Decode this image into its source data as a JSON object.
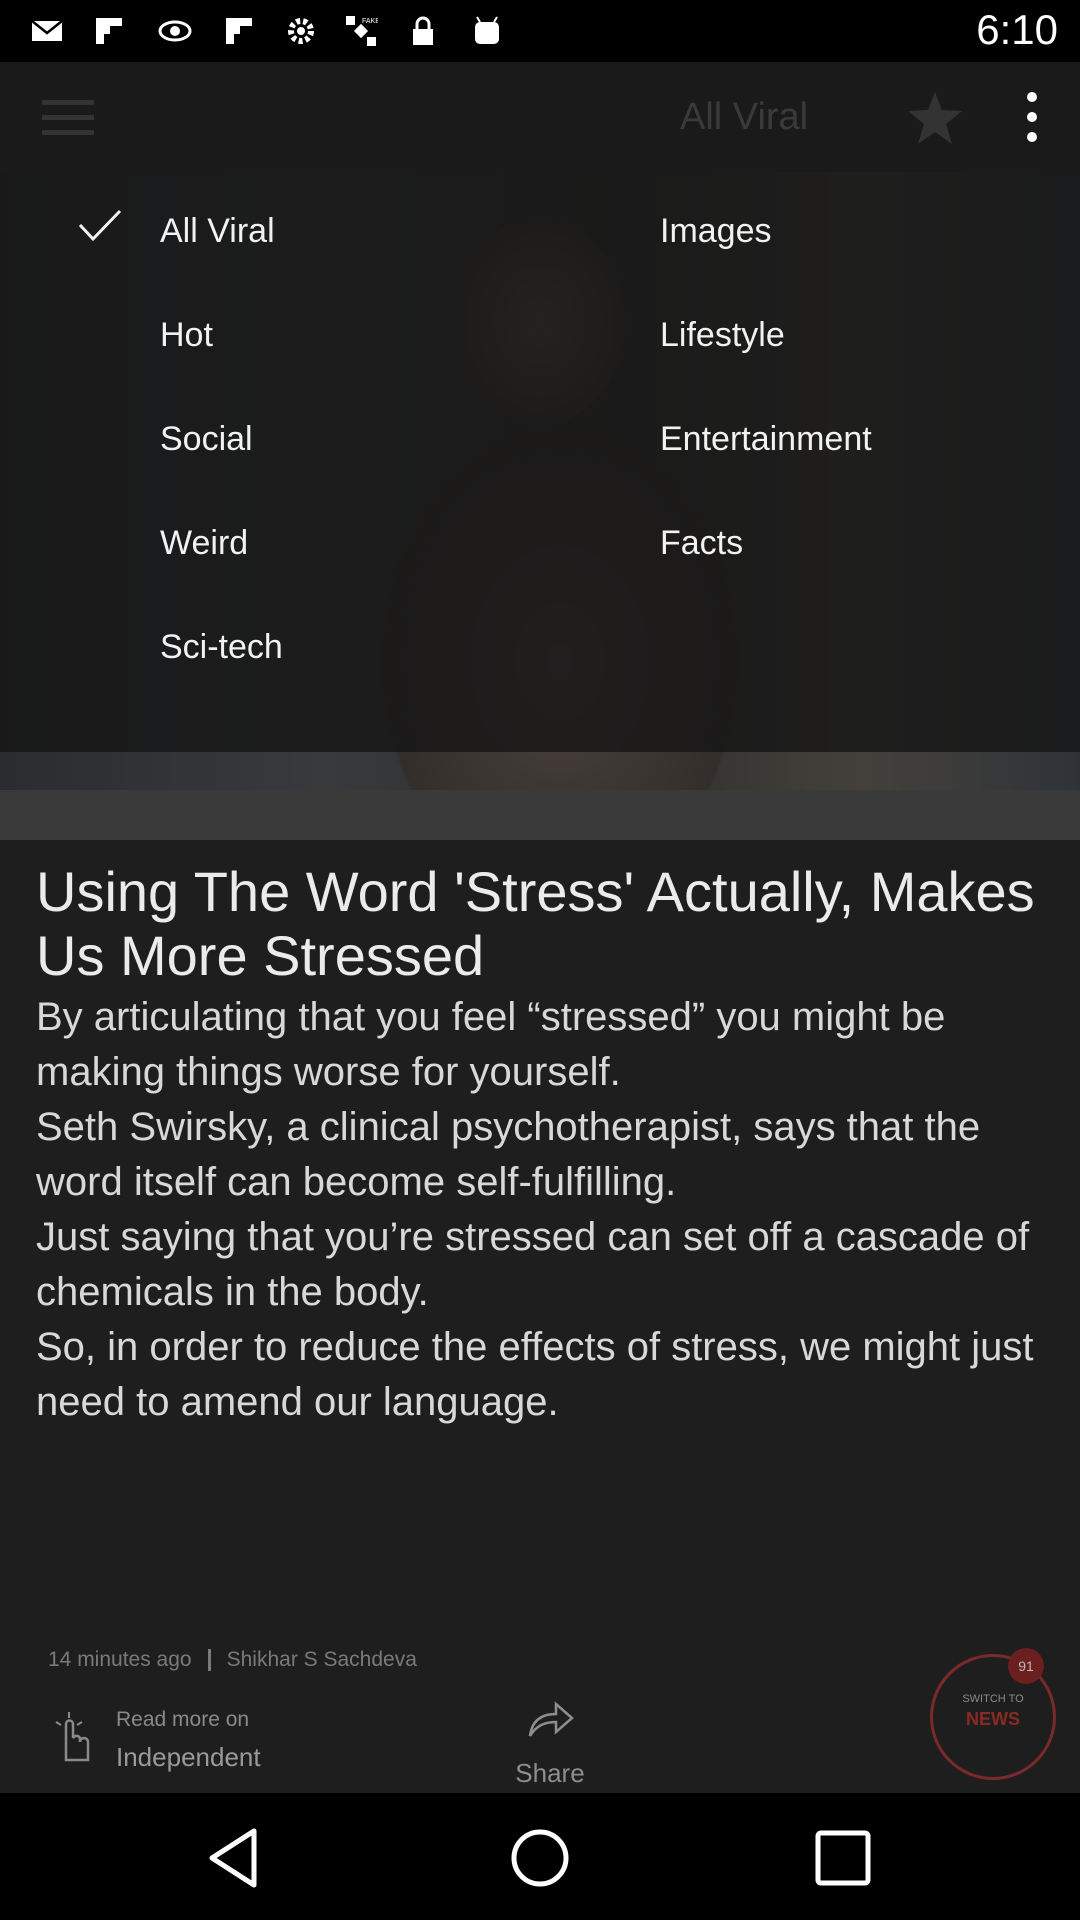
{
  "status_bar": {
    "time": "6:10",
    "icons": [
      "mail-icon",
      "flipboard-icon",
      "eye-icon",
      "flipboard-icon",
      "gear-icon",
      "satellite-icon",
      "lock-icon",
      "android-icon"
    ]
  },
  "app_bar": {
    "title": "All Viral",
    "icons": [
      "menu-icon",
      "star-icon",
      "more-vert-icon"
    ]
  },
  "filter_menu": {
    "selected": "All Viral",
    "left_column": [
      "All Viral",
      "Hot",
      "Social",
      "Weird",
      "Sci-tech"
    ],
    "right_column": [
      "Images",
      "Lifestyle",
      "Entertainment",
      "Facts"
    ]
  },
  "article": {
    "headline": "Using The Word 'Stress' Actually, Makes Us More Stressed",
    "body": "By articulating that you feel “stressed” you might be making things worse for yourself.\nSeth Swirsky, a clinical psychotherapist, says that the word itself can become self-fulfilling.\nJust saying that you’re stressed can set off a cascade of chemicals in the body.\nSo, in order to reduce the effects of stress, we might just need to amend our language.",
    "time_ago": "14 minutes ago",
    "author": "Shikhar S Sachdeva",
    "read_more_label": "Read more on",
    "source": "Independent",
    "share_label": "Share"
  },
  "switch_button": {
    "small_label": "SWITCH TO",
    "big_label": "NEWS",
    "badge_count": "91"
  },
  "colors": {
    "menu_overlay": "#141414",
    "accent_red": "#8a2a24",
    "text_primary": "#f2f2f2"
  },
  "nav_bar": {
    "buttons": [
      "back-icon",
      "home-icon",
      "recents-icon"
    ]
  }
}
